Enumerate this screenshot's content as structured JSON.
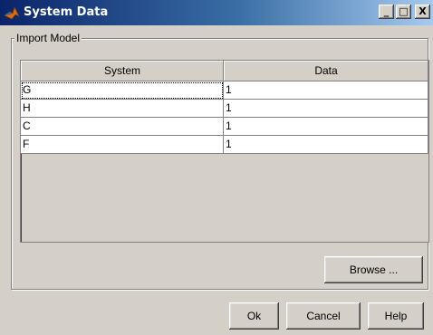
{
  "window": {
    "title": "System Data",
    "minimize_label": "_",
    "maximize_label": "□",
    "close_label": "X"
  },
  "group": {
    "label": "Import Model"
  },
  "table": {
    "columns": [
      "System",
      "Data"
    ],
    "rows": [
      [
        "G",
        "1"
      ],
      [
        "H",
        "1"
      ],
      [
        "C",
        "1"
      ],
      [
        "F",
        "1"
      ]
    ]
  },
  "buttons": {
    "browse": "Browse ...",
    "ok": "Ok",
    "cancel": "Cancel",
    "help": "Help"
  },
  "icons": {
    "app": "matlab-icon"
  },
  "colors": {
    "titlebar_start": "#0a246a",
    "titlebar_end": "#a6caf0",
    "face": "#d4d0c8"
  }
}
